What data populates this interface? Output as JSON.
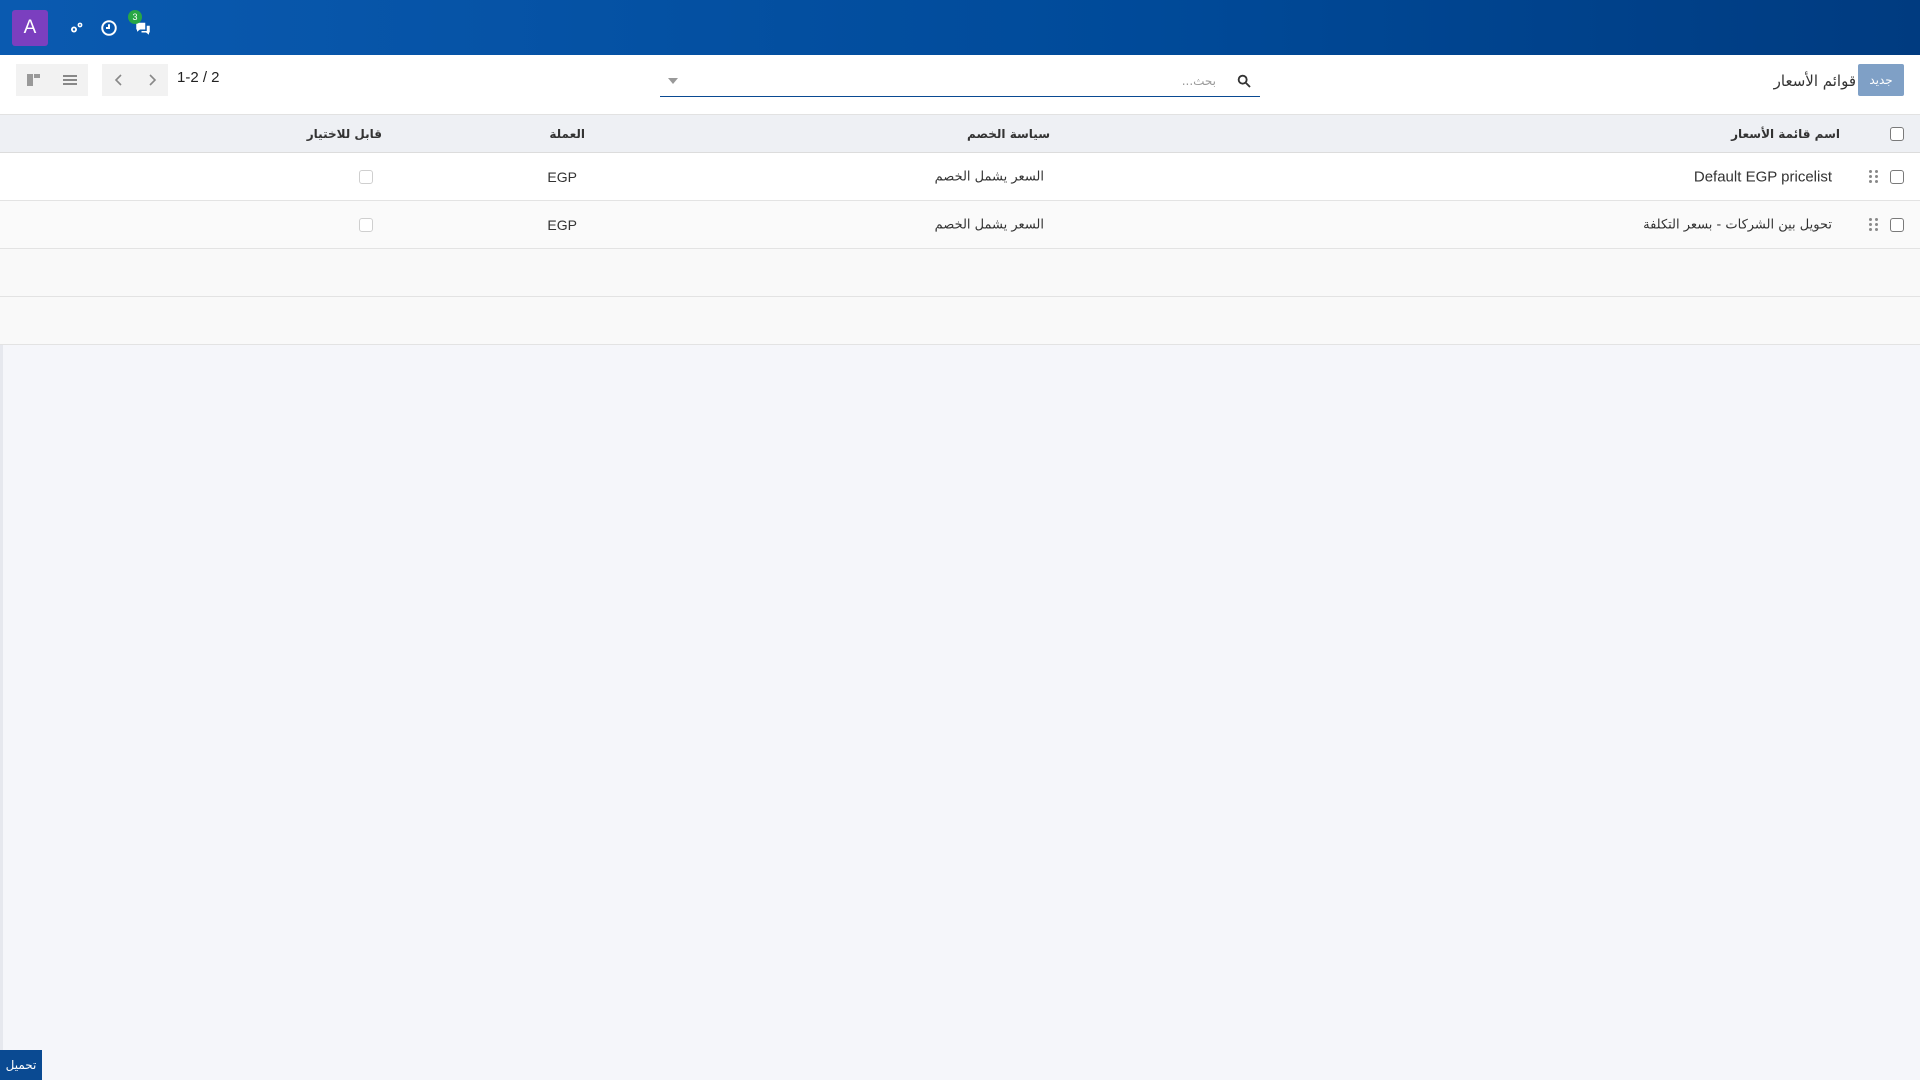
{
  "navbar": {
    "avatar_letter": "A",
    "icons": [
      "tools-icon",
      "clock-icon",
      "chat-icon"
    ],
    "chat_badge": "3",
    "background": "#004a99"
  },
  "control": {
    "new_button": "جديد",
    "breadcrumb": "قوائم الأسعار",
    "search_placeholder": "بحث...",
    "pager_text": "1-2 / 2"
  },
  "table": {
    "headers": {
      "name": "اسم قائمة الأسعار",
      "discount": "سياسة الخصم",
      "currency": "العملة",
      "selectable": "قابل للاختيار"
    },
    "rows": [
      {
        "name": "Default EGP pricelist",
        "discount": "السعر يشمل الخصم",
        "currency": "EGP"
      },
      {
        "name": "تحويل بين الشركات - بسعر التكلفة",
        "discount": "السعر يشمل الخصم",
        "currency": "EGP"
      }
    ]
  },
  "footer": {
    "load_button": "تحميل"
  }
}
